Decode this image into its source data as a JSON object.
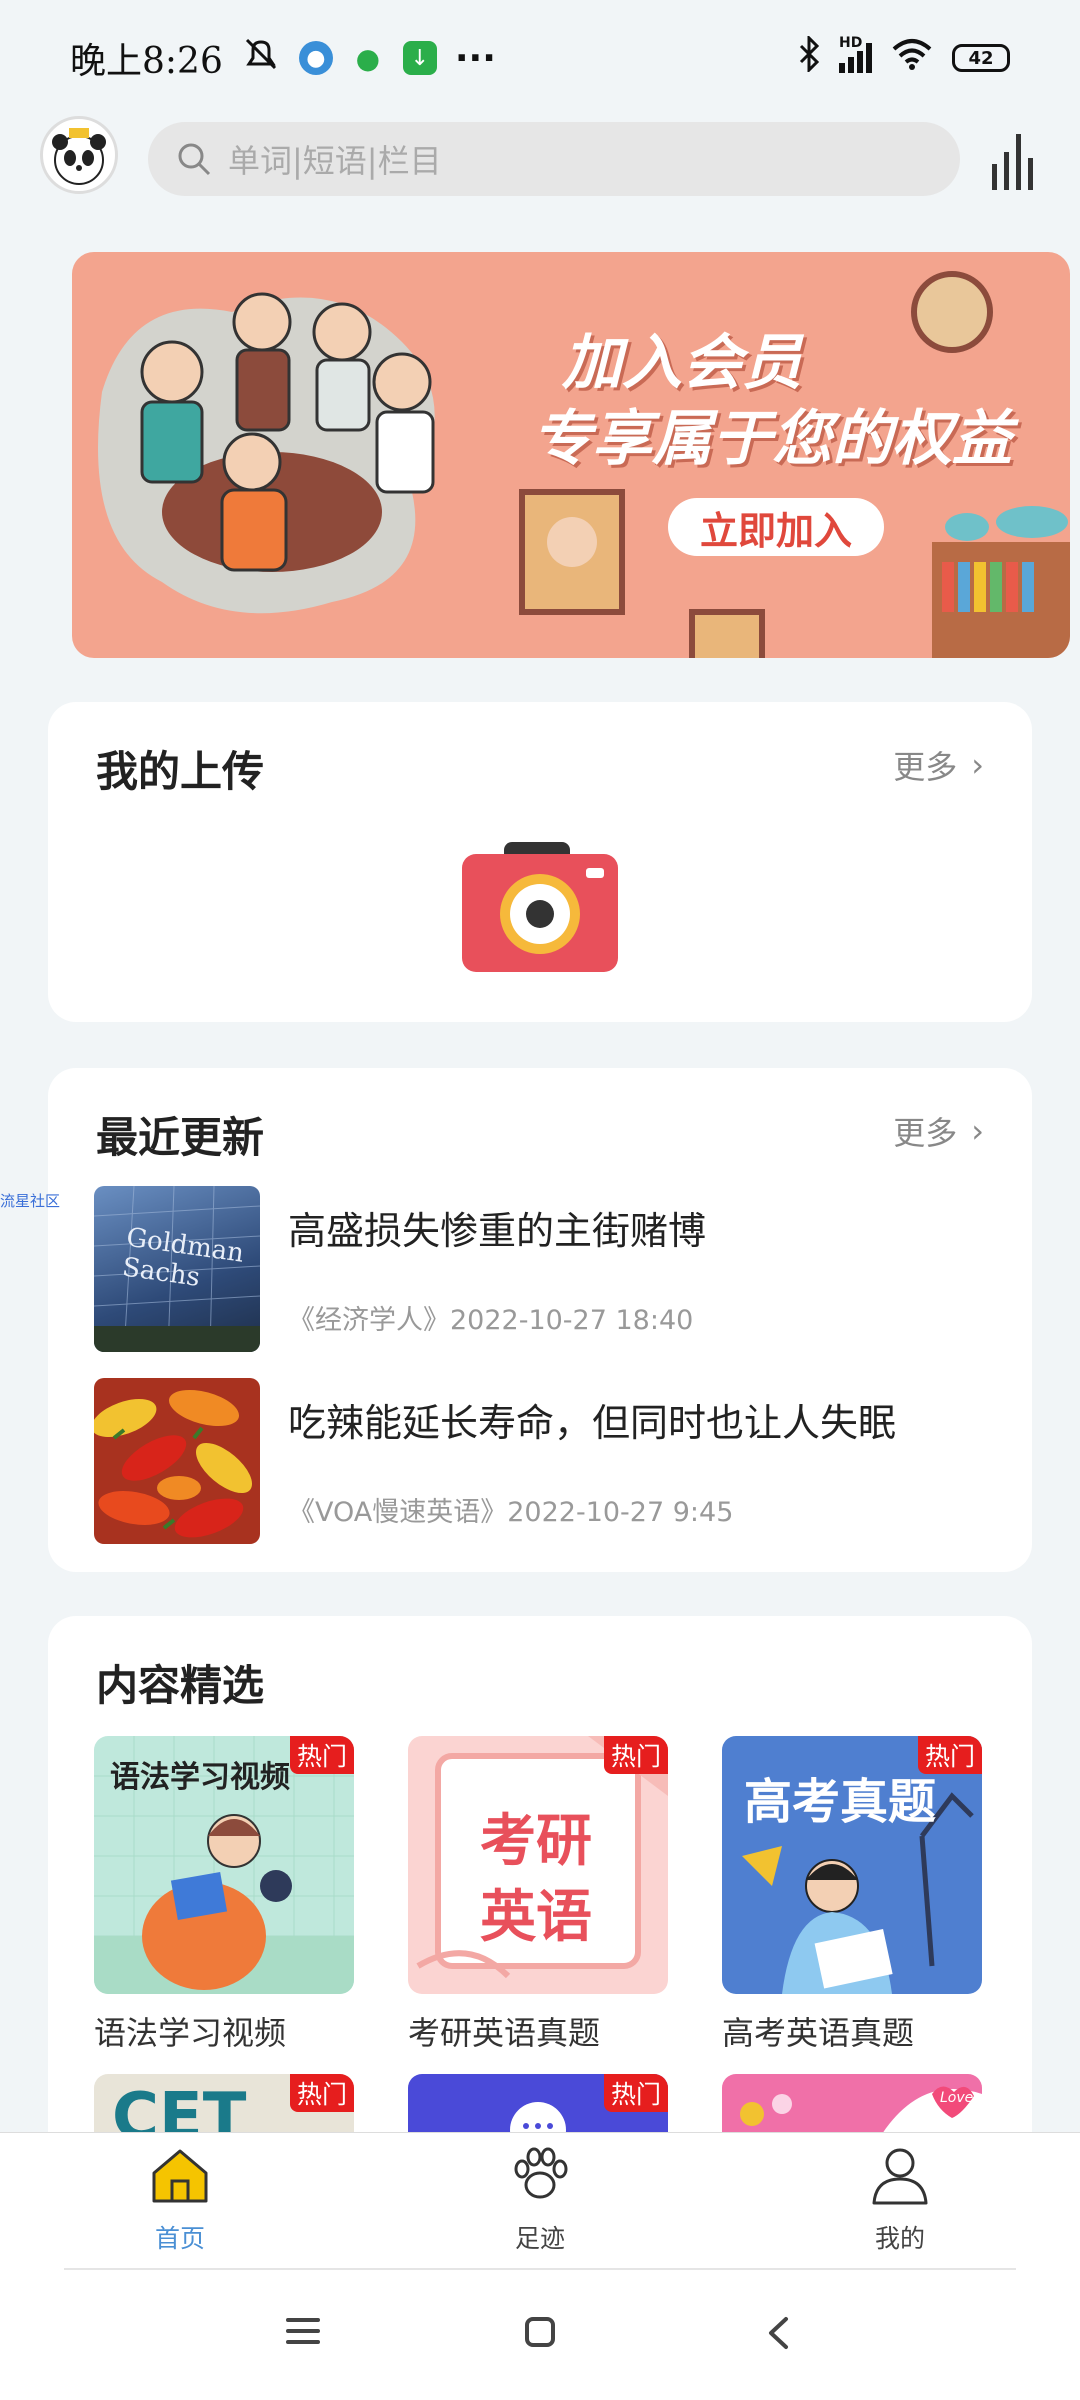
{
  "status_bar": {
    "time": "晚上8:26",
    "more": "···",
    "network": "HD",
    "battery": "42"
  },
  "search": {
    "placeholder": "单词|短语|栏目"
  },
  "banner": {
    "line1": "加入会员",
    "line2": "专享属于您的权益",
    "button": "立即加入"
  },
  "uploads": {
    "title": "我的上传",
    "more": "更多"
  },
  "recent": {
    "title": "最近更新",
    "more": "更多",
    "items": [
      {
        "title": "高盛损失惨重的主街赌博",
        "meta": "《经济学人》2022-10-27 18:40",
        "thumb_text": "Goldman Sachs"
      },
      {
        "title": "吃辣能延长寿命，但同时也让人失眠",
        "meta": "《VOA慢速英语》2022-10-27 9:45"
      }
    ]
  },
  "side_tag": "流星社区",
  "selection": {
    "title": "内容精选",
    "hot": "热门",
    "tiles": [
      {
        "label": "语法学习视频",
        "art_text": "语法学习视频"
      },
      {
        "label": "考研英语真题",
        "art_text1": "考研",
        "art_text2": "英语"
      },
      {
        "label": "高考英语真题",
        "art_text": "高考真题"
      }
    ],
    "row2": [
      {
        "art_text": "CET"
      },
      {
        "art_text": ""
      },
      {
        "art_text": "Love"
      }
    ]
  },
  "bottom_nav": {
    "items": [
      {
        "label": "首页",
        "active": true
      },
      {
        "label": "足迹",
        "active": false
      },
      {
        "label": "我的",
        "active": false
      }
    ]
  },
  "colors": {
    "accent": "#4a8fd4",
    "hot": "#e61e1e",
    "banner": "#f3a48e",
    "home_icon": "#f5c400"
  }
}
